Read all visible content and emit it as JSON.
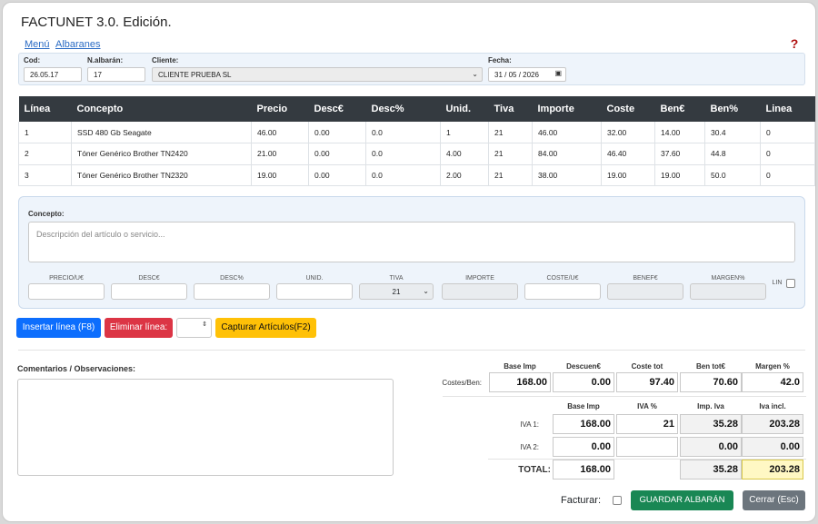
{
  "app": {
    "title": "FACTUNET 3.0. Edición.",
    "nav": [
      "Menú",
      "Albaranes"
    ],
    "help_icon": "?"
  },
  "header": {
    "cod": {
      "label": "Cod:",
      "value": "26.05.17"
    },
    "albaran": {
      "label": "N.albarán:",
      "value": "17"
    },
    "cliente": {
      "label": "Cliente:",
      "value": "CLIENTE PRUEBA SL"
    },
    "fecha": {
      "label": "Fecha:",
      "value": "31 / 05 / 2026"
    }
  },
  "table": {
    "columns": [
      "Línea",
      "Concepto",
      "Precio",
      "Desc€",
      "Desc%",
      "Unid.",
      "Tiva",
      "Importe",
      "Coste",
      "Ben€",
      "Ben%",
      "Linea"
    ],
    "rows": [
      [
        "1",
        "SSD 480 Gb Seagate",
        "46.00",
        "0.00",
        "0.0",
        "1",
        "21",
        "46.00",
        "32.00",
        "14.00",
        "30.4",
        "0"
      ],
      [
        "2",
        "Tóner Genérico Brother TN2420",
        "21.00",
        "0.00",
        "0.0",
        "4.00",
        "21",
        "84.00",
        "46.40",
        "37.60",
        "44.8",
        "0"
      ],
      [
        "3",
        "Tóner Genérico Brother TN2320",
        "19.00",
        "0.00",
        "0.0",
        "2.00",
        "21",
        "38.00",
        "19.00",
        "19.00",
        "50.0",
        "0"
      ]
    ]
  },
  "editor": {
    "concepto_label": "Concepto:",
    "concepto_placeholder": "Descripción del artículo o servicio...",
    "fields": [
      "PRECIO/U€",
      "DESC€",
      "DESC%",
      "UNID.",
      "TIVA",
      "IMPORTE",
      "COSTE/U€",
      "BENEF€",
      "MARGEN%"
    ],
    "tiva_value": "21",
    "lin_label": "LIN"
  },
  "actions": {
    "insert": "Insertar línea (F8)",
    "delete": "Eliminar línea:",
    "capture": "Capturar Artículos(F2)"
  },
  "comments": {
    "label": "Comentarios / Observaciones:"
  },
  "summary": {
    "top_headers": [
      "Base Imp",
      "Descuen€",
      "Coste tot",
      "Ben tot€",
      "Margen %"
    ],
    "costes_label": "Costes/Ben:",
    "costes_values": [
      "168.00",
      "0.00",
      "97.40",
      "70.60",
      "42.0"
    ],
    "iva_headers": [
      "Base Imp",
      "IVA %",
      "Imp. Iva",
      "Iva incl."
    ],
    "iva1": {
      "label": "IVA 1:",
      "values": [
        "168.00",
        "21",
        "35.28",
        "203.28"
      ]
    },
    "iva2": {
      "label": "IVA 2:",
      "values": [
        "0.00",
        "",
        "0.00",
        "0.00"
      ]
    },
    "total": {
      "label": "TOTAL:",
      "values": [
        "168.00",
        "",
        "35.28",
        "203.28"
      ]
    }
  },
  "footer": {
    "facturar_label": "Facturar:",
    "save": "GUARDAR ALBARÁN",
    "close": "Cerrar (Esc)"
  },
  "colors": {
    "table_header": "#343a40",
    "insert_btn": "#0d6efd",
    "delete_btn": "#dc3545",
    "capture_btn": "#ffc107",
    "save_btn": "#198754",
    "close_btn": "#6c757d",
    "total_highlight": "#fff8c4"
  }
}
